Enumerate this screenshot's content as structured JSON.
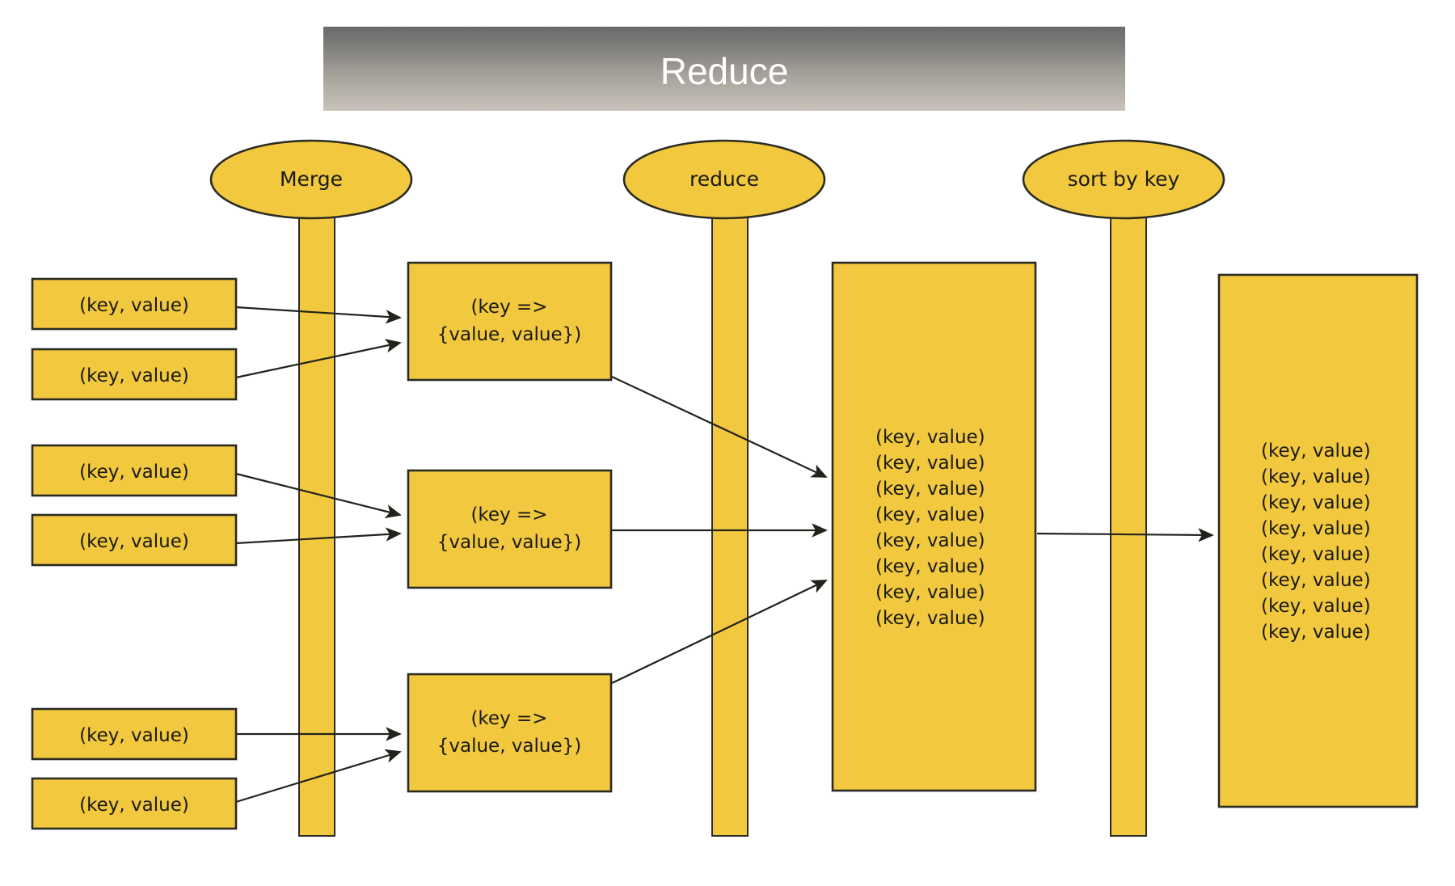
{
  "title_banner": {
    "label": "Reduce",
    "gradient_top": "#6d6d6d",
    "gradient_bottom": "#c6c0b7",
    "text_color": "#ffffff"
  },
  "theme": {
    "node_fill": "#f2c83f",
    "node_stroke": "#2b2b23",
    "arrow_color": "#2b2b23",
    "background": "#ffffff"
  },
  "stages": [
    {
      "id": "merge",
      "label": "Merge"
    },
    {
      "id": "reduce",
      "label": "reduce"
    },
    {
      "id": "sort-by-key",
      "label": "sort by key"
    }
  ],
  "input_pairs": [
    {
      "label": "(key, value)"
    },
    {
      "label": "(key, value)"
    },
    {
      "label": "(key, value)"
    },
    {
      "label": "(key, value)"
    },
    {
      "label": "(key, value)"
    },
    {
      "label": "(key, value)"
    }
  ],
  "merged_groups": [
    {
      "line1": "(key =>",
      "line2": "{value, value})"
    },
    {
      "line1": "(key =>",
      "line2": "{value, value})"
    },
    {
      "line1": "(key =>",
      "line2": "{value, value})"
    }
  ],
  "reduced_output": {
    "lines": [
      "(key, value)",
      "(key, value)",
      "(key, value)",
      "(key, value)",
      "(key, value)",
      "(key, value)",
      "(key, value)",
      "(key, value)"
    ]
  },
  "sorted_output": {
    "lines": [
      "(key, value)",
      "(key, value)",
      "(key, value)",
      "(key, value)",
      "(key, value)",
      "(key, value)",
      "(key, value)",
      "(key, value)"
    ]
  }
}
